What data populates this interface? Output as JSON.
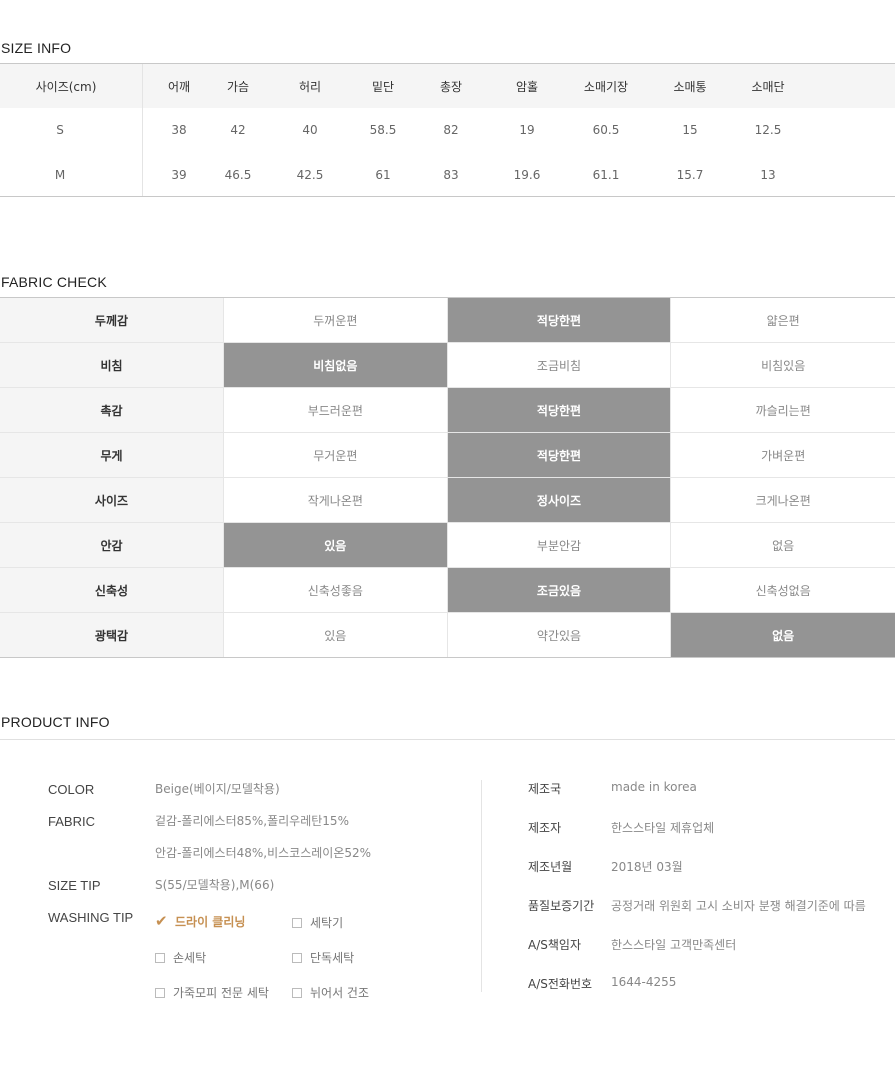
{
  "size_info": {
    "title": "SIZE INFO",
    "headers": [
      "사이즈(cm)",
      "어깨",
      "가슴",
      "허리",
      "밑단",
      "총장",
      "암홀",
      "소매기장",
      "소매통",
      "소매단"
    ],
    "rows": [
      [
        "S",
        "38",
        "42",
        "40",
        "58.5",
        "82",
        "19",
        "60.5",
        "15",
        "12.5"
      ],
      [
        "M",
        "39",
        "46.5",
        "42.5",
        "61",
        "83",
        "19.6",
        "61.1",
        "15.7",
        "13"
      ]
    ]
  },
  "fabric_check": {
    "title": "FABRIC CHECK",
    "rows": [
      {
        "label": "두께감",
        "options": [
          "두꺼운편",
          "적당한편",
          "얇은편"
        ],
        "selected": 1
      },
      {
        "label": "비침",
        "options": [
          "비침없음",
          "조금비침",
          "비침있음"
        ],
        "selected": 0
      },
      {
        "label": "촉감",
        "options": [
          "부드러운편",
          "적당한편",
          "까슬리는편"
        ],
        "selected": 1
      },
      {
        "label": "무게",
        "options": [
          "무거운편",
          "적당한편",
          "가벼운편"
        ],
        "selected": 1
      },
      {
        "label": "사이즈",
        "options": [
          "작게나온편",
          "정사이즈",
          "크게나온편"
        ],
        "selected": 1
      },
      {
        "label": "안감",
        "options": [
          "있음",
          "부분안감",
          "없음"
        ],
        "selected": 0
      },
      {
        "label": "신축성",
        "options": [
          "신축성좋음",
          "조금있음",
          "신축성없음"
        ],
        "selected": 1
      },
      {
        "label": "광택감",
        "options": [
          "있음",
          "약간있음",
          "없음"
        ],
        "selected": 2
      }
    ]
  },
  "product_info": {
    "title": "PRODUCT INFO",
    "color_label": "COLOR",
    "color_value": "Beige(베이지/모델착용)",
    "fabric_label": "FABRIC",
    "fabric_value_1": "겉감-폴리에스터85%,폴리우레탄15%",
    "fabric_value_2": "안감-폴리에스터48%,비스코스레이온52%",
    "size_tip_label": "SIZE TIP",
    "size_tip_value": "S(55/모델착용),M(66)",
    "washing_tip_label": "WASHING TIP",
    "washing": [
      {
        "label": "드라이 클리닝",
        "checked": true
      },
      {
        "label": "세탁기",
        "checked": false
      },
      {
        "label": "손세탁",
        "checked": false
      },
      {
        "label": "단독세탁",
        "checked": false
      },
      {
        "label": "가죽모피 전문 세탁",
        "checked": false
      },
      {
        "label": "뉘어서 건조",
        "checked": false
      }
    ],
    "details": [
      {
        "label": "제조국",
        "value": "made in korea"
      },
      {
        "label": "제조자",
        "value": "한스스타일 제휴업체"
      },
      {
        "label": "제조년월",
        "value": "2018년 03월"
      },
      {
        "label": "품질보증기간",
        "value": "공정거래 위원회 고시 소비자 분쟁 해결기준에 따름"
      },
      {
        "label": "A/S책임자",
        "value": "한스스타일 고객만족센터"
      },
      {
        "label": "A/S전화번호",
        "value": "1644-4255"
      }
    ]
  }
}
